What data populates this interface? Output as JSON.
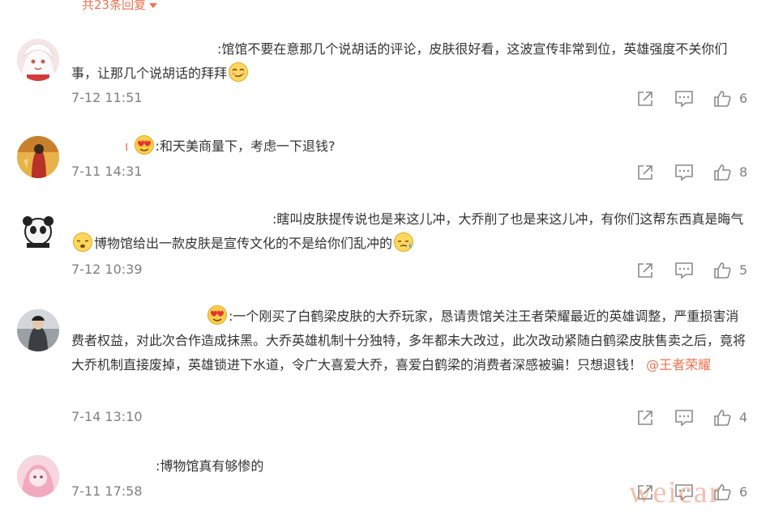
{
  "header": {
    "reply_count": "共23条回复"
  },
  "comments": [
    {
      "text1": ":馆馆不要在意那几个说胡话的评论，皮肤很好看，这波宣传非常到位，英雄强度不关你们事，让那几个说胡话的拜拜",
      "time": "7-12 11:51",
      "likes": "6"
    },
    {
      "prefix": "ı",
      "text1": ":和天美商量下，考虑一下退钱?",
      "time": "7-11 14:31",
      "likes": "8"
    },
    {
      "text1": ":瞎叫皮肤提传说也是来这儿冲，大乔削了也是来这儿冲，有你们这帮东西真是晦气",
      "text2": "博物馆给出一款皮肤是宣传文化的不是给你们乱冲的",
      "time": "7-12 10:39",
      "likes": "5"
    },
    {
      "text1": ":一个刚买了白鹤梁皮肤的大乔玩家，恳请贵馆关注王者荣耀最近的英雄调整，严重损害消费者权益，对此次合作造成抹黑。大乔英雄机制十分独特，多年都未大改过，此次改动紧随白鹤梁皮肤售卖之后，竟将大乔机制直接废掉，英雄锁进下水道，令广大喜爱大乔，喜爱白鹤梁的消费者深感被骗！只想退钱！",
      "mention": "@王者荣耀",
      "time": "7-14 13:10",
      "likes": "4"
    },
    {
      "text1": ":博物馆真有够惨的",
      "time": "7-11 17:58",
      "likes": "6"
    }
  ],
  "watermark": "weicar",
  "icons": {
    "share": "share-icon",
    "comment": "comment-icon",
    "like": "thumbs-up-icon",
    "emoji_smile": "smug-face-emoji",
    "emoji_love": "heart-eyes-emoji",
    "emoji_sad": "disappointed-face-emoji",
    "emoji_sweat": "cold-sweat-emoji"
  },
  "colors": {
    "accent": "#eb7350",
    "text": "#333333",
    "meta": "#808080"
  }
}
